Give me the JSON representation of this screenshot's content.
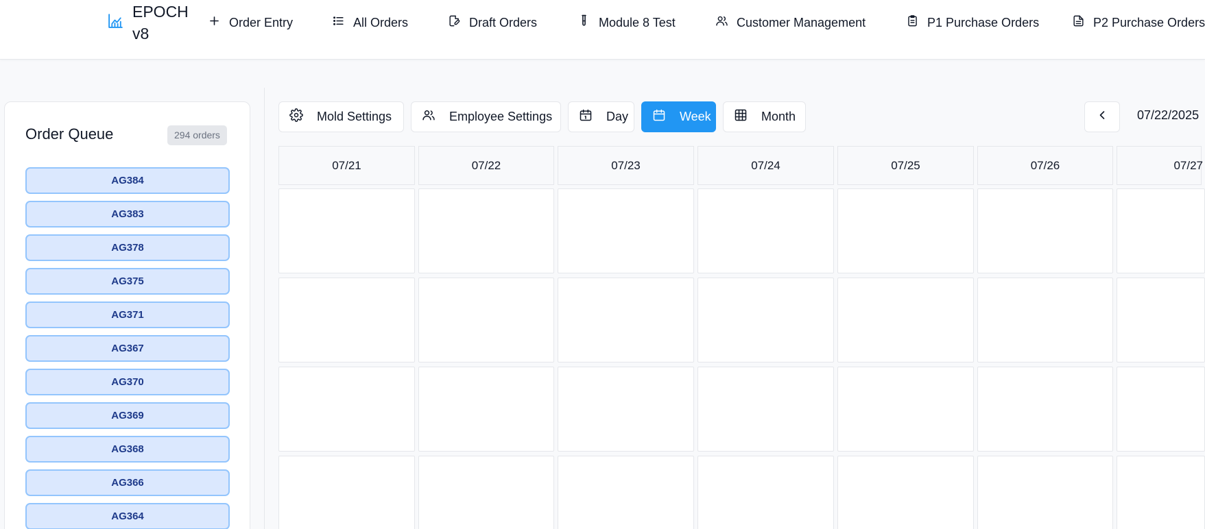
{
  "app": {
    "name": "EPOCH v8"
  },
  "nav": {
    "items": [
      {
        "label": "Order Entry",
        "icon": "plus-icon"
      },
      {
        "label": "All Orders",
        "icon": "list-icon"
      },
      {
        "label": "Draft Orders",
        "icon": "edit-document-icon"
      },
      {
        "label": "Module 8 Test",
        "icon": "test-tube-icon"
      },
      {
        "label": "Customer Management",
        "icon": "users-icon"
      },
      {
        "label": "P1 Purchase Orders",
        "icon": "clipboard-icon"
      },
      {
        "label": "P2 Purchase Orders",
        "icon": "document-icon"
      }
    ]
  },
  "queue": {
    "title": "Order Queue",
    "count_badge": "294 orders",
    "orders": [
      "AG384",
      "AG383",
      "AG378",
      "AG375",
      "AG371",
      "AG367",
      "AG370",
      "AG369",
      "AG368",
      "AG366",
      "AG364"
    ]
  },
  "toolbar": {
    "mold_settings": "Mold Settings",
    "employee_settings": "Employee Settings",
    "day": "Day",
    "week": "Week",
    "month": "Month",
    "active_view": "Week",
    "current_date": "07/22/2025"
  },
  "calendar": {
    "days": [
      "07/21",
      "07/22",
      "07/23",
      "07/24",
      "07/25",
      "07/26",
      "07/27"
    ]
  },
  "colors": {
    "accent": "#2196f3",
    "queue_item_bg": "#dbe8fe",
    "queue_item_border": "#93c5fd",
    "queue_item_text": "#1e3a8a",
    "brand_icon": "#2196f3"
  }
}
